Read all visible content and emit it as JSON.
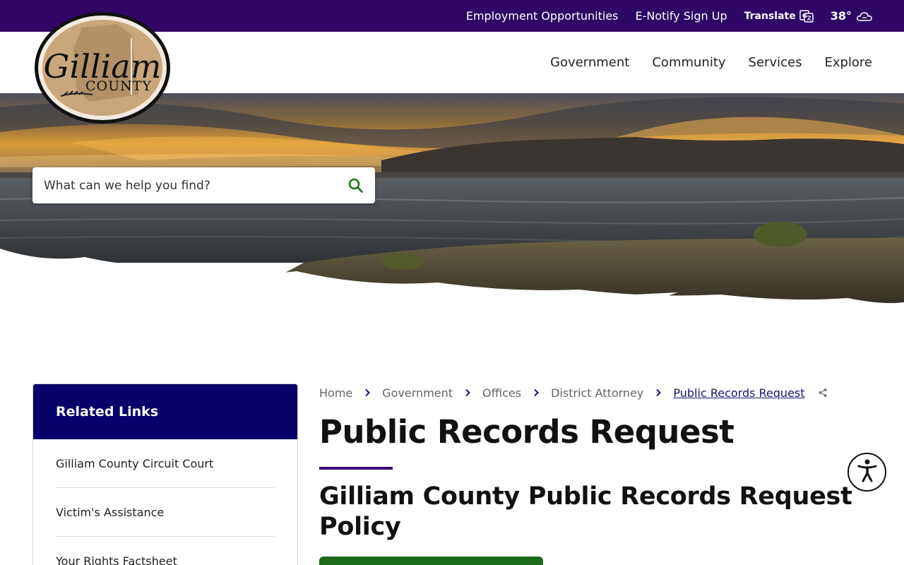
{
  "utility": {
    "links": [
      "Employment Opportunities",
      "E-Notify Sign Up"
    ],
    "translate_label": "Translate",
    "weather_temp": "38°"
  },
  "logo": {
    "line1": "Gilliam",
    "line2": "COUNTY"
  },
  "nav": {
    "items": [
      "Government",
      "Community",
      "Services",
      "Explore"
    ]
  },
  "search": {
    "placeholder": "What can we help you find?"
  },
  "sidebar": {
    "title": "Related Links",
    "items": [
      "Gilliam County Circuit Court",
      "Victim's Assistance",
      "Your Rights Factsheet"
    ]
  },
  "breadcrumb": {
    "items": [
      "Home",
      "Government",
      "Offices",
      "District Attorney"
    ],
    "current": "Public Records Request"
  },
  "page": {
    "title": "Public Records Request",
    "subtitle": "Gilliam County Public Records Request Policy"
  },
  "colors": {
    "utility_bar": "#2f0666",
    "sidebar_header": "#07006b",
    "accent_underline": "#3a0a75",
    "search_icon": "#1b7a1b",
    "button_green": "#1b6b1b"
  }
}
